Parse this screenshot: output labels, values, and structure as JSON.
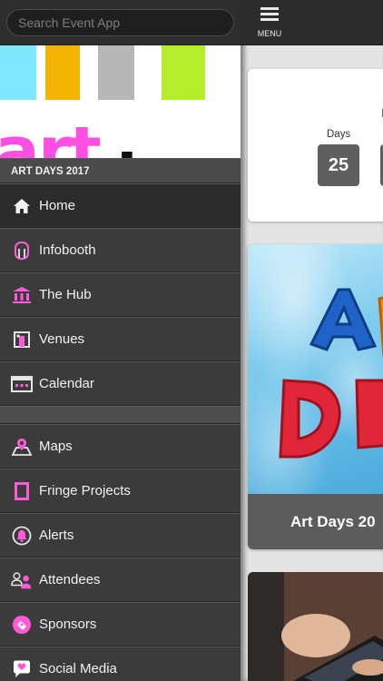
{
  "search": {
    "placeholder": "Search Event App"
  },
  "banner": {
    "word1": "art",
    "word2": "days"
  },
  "section": {
    "title": "ART DAYS 2017"
  },
  "menu_primary": [
    {
      "label": "Home",
      "icon": "home-icon"
    },
    {
      "label": "Infobooth",
      "icon": "infobooth-icon"
    },
    {
      "label": "The Hub",
      "icon": "building-icon"
    },
    {
      "label": "Venues",
      "icon": "venue-icon"
    },
    {
      "label": "Calendar",
      "icon": "calendar-icon"
    }
  ],
  "menu_secondary": [
    {
      "label": "Maps",
      "icon": "map-pin-icon"
    },
    {
      "label": "Fringe Projects",
      "icon": "frame-icon"
    },
    {
      "label": "Alerts",
      "icon": "alert-icon"
    },
    {
      "label": "Attendees",
      "icon": "attendees-icon"
    },
    {
      "label": "Sponsors",
      "icon": "sponsor-icon"
    },
    {
      "label": "Social Media",
      "icon": "social-icon"
    }
  ],
  "topbar": {
    "menu_label": "MENU"
  },
  "countdown": {
    "label": "Days",
    "value": "25",
    "header_letter": "I"
  },
  "feature": {
    "caption": "Art Days 20"
  },
  "colors": {
    "accent": "#ff4fe3",
    "sidebar_bg": "#3a3a3a",
    "topbar_bg": "#2c2c2c",
    "main_bg": "#e4e4e4"
  }
}
